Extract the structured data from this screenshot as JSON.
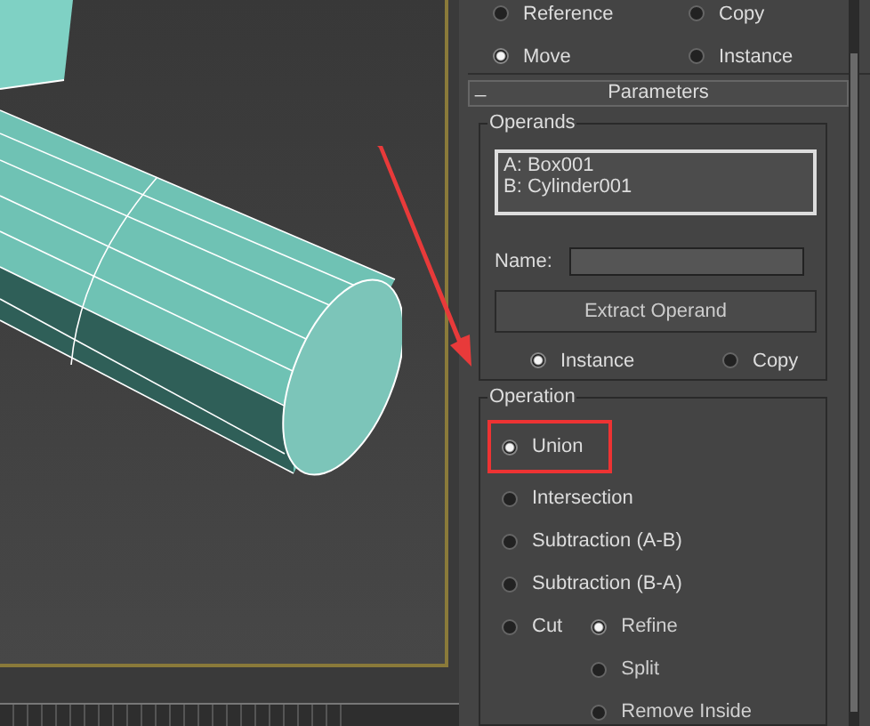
{
  "clone_options": {
    "radios": [
      {
        "label": "Reference",
        "selected": false
      },
      {
        "label": "Copy",
        "selected": false
      },
      {
        "label": "Move",
        "selected": true
      },
      {
        "label": "Instance",
        "selected": false
      }
    ]
  },
  "parameters": {
    "toggle": "_",
    "title": "Parameters",
    "operands": {
      "title": "Operands",
      "items": [
        "A: Box001",
        "B: Cylinder001"
      ],
      "name_label": "Name:",
      "extract_button": "Extract Operand",
      "copy_mode": [
        {
          "label": "Instance",
          "selected": true
        },
        {
          "label": "Copy",
          "selected": false
        }
      ]
    },
    "operation": {
      "title": "Operation",
      "options": [
        {
          "label": "Union",
          "selected": true,
          "highlighted": true
        },
        {
          "label": "Intersection",
          "selected": false,
          "highlighted": false
        },
        {
          "label": "Subtraction (A-B)",
          "selected": false,
          "highlighted": false
        },
        {
          "label": "Subtraction (B-A)",
          "selected": false,
          "highlighted": false
        },
        {
          "label": "Cut",
          "selected": false,
          "highlighted": false
        }
      ],
      "cut_options": [
        {
          "label": "Refine",
          "selected": true
        },
        {
          "label": "Split",
          "selected": false
        },
        {
          "label": "Remove Inside",
          "selected": false
        }
      ]
    }
  }
}
